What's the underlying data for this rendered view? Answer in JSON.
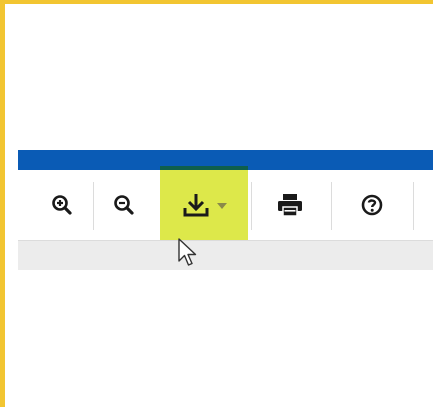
{
  "highlight_border_color": "#f2c531",
  "header_bar_color": "#0a5bb5",
  "toolbar": {
    "buttons": [
      {
        "icon": "zoom-in-icon"
      },
      {
        "icon": "zoom-out-icon"
      },
      {
        "icon": "download-icon",
        "highlighted": true,
        "highlight_color": "#dde84a",
        "has_dropdown": true
      },
      {
        "icon": "print-icon"
      },
      {
        "icon": "help-icon"
      }
    ]
  },
  "cursor_icon": "arrow-pointer-icon"
}
